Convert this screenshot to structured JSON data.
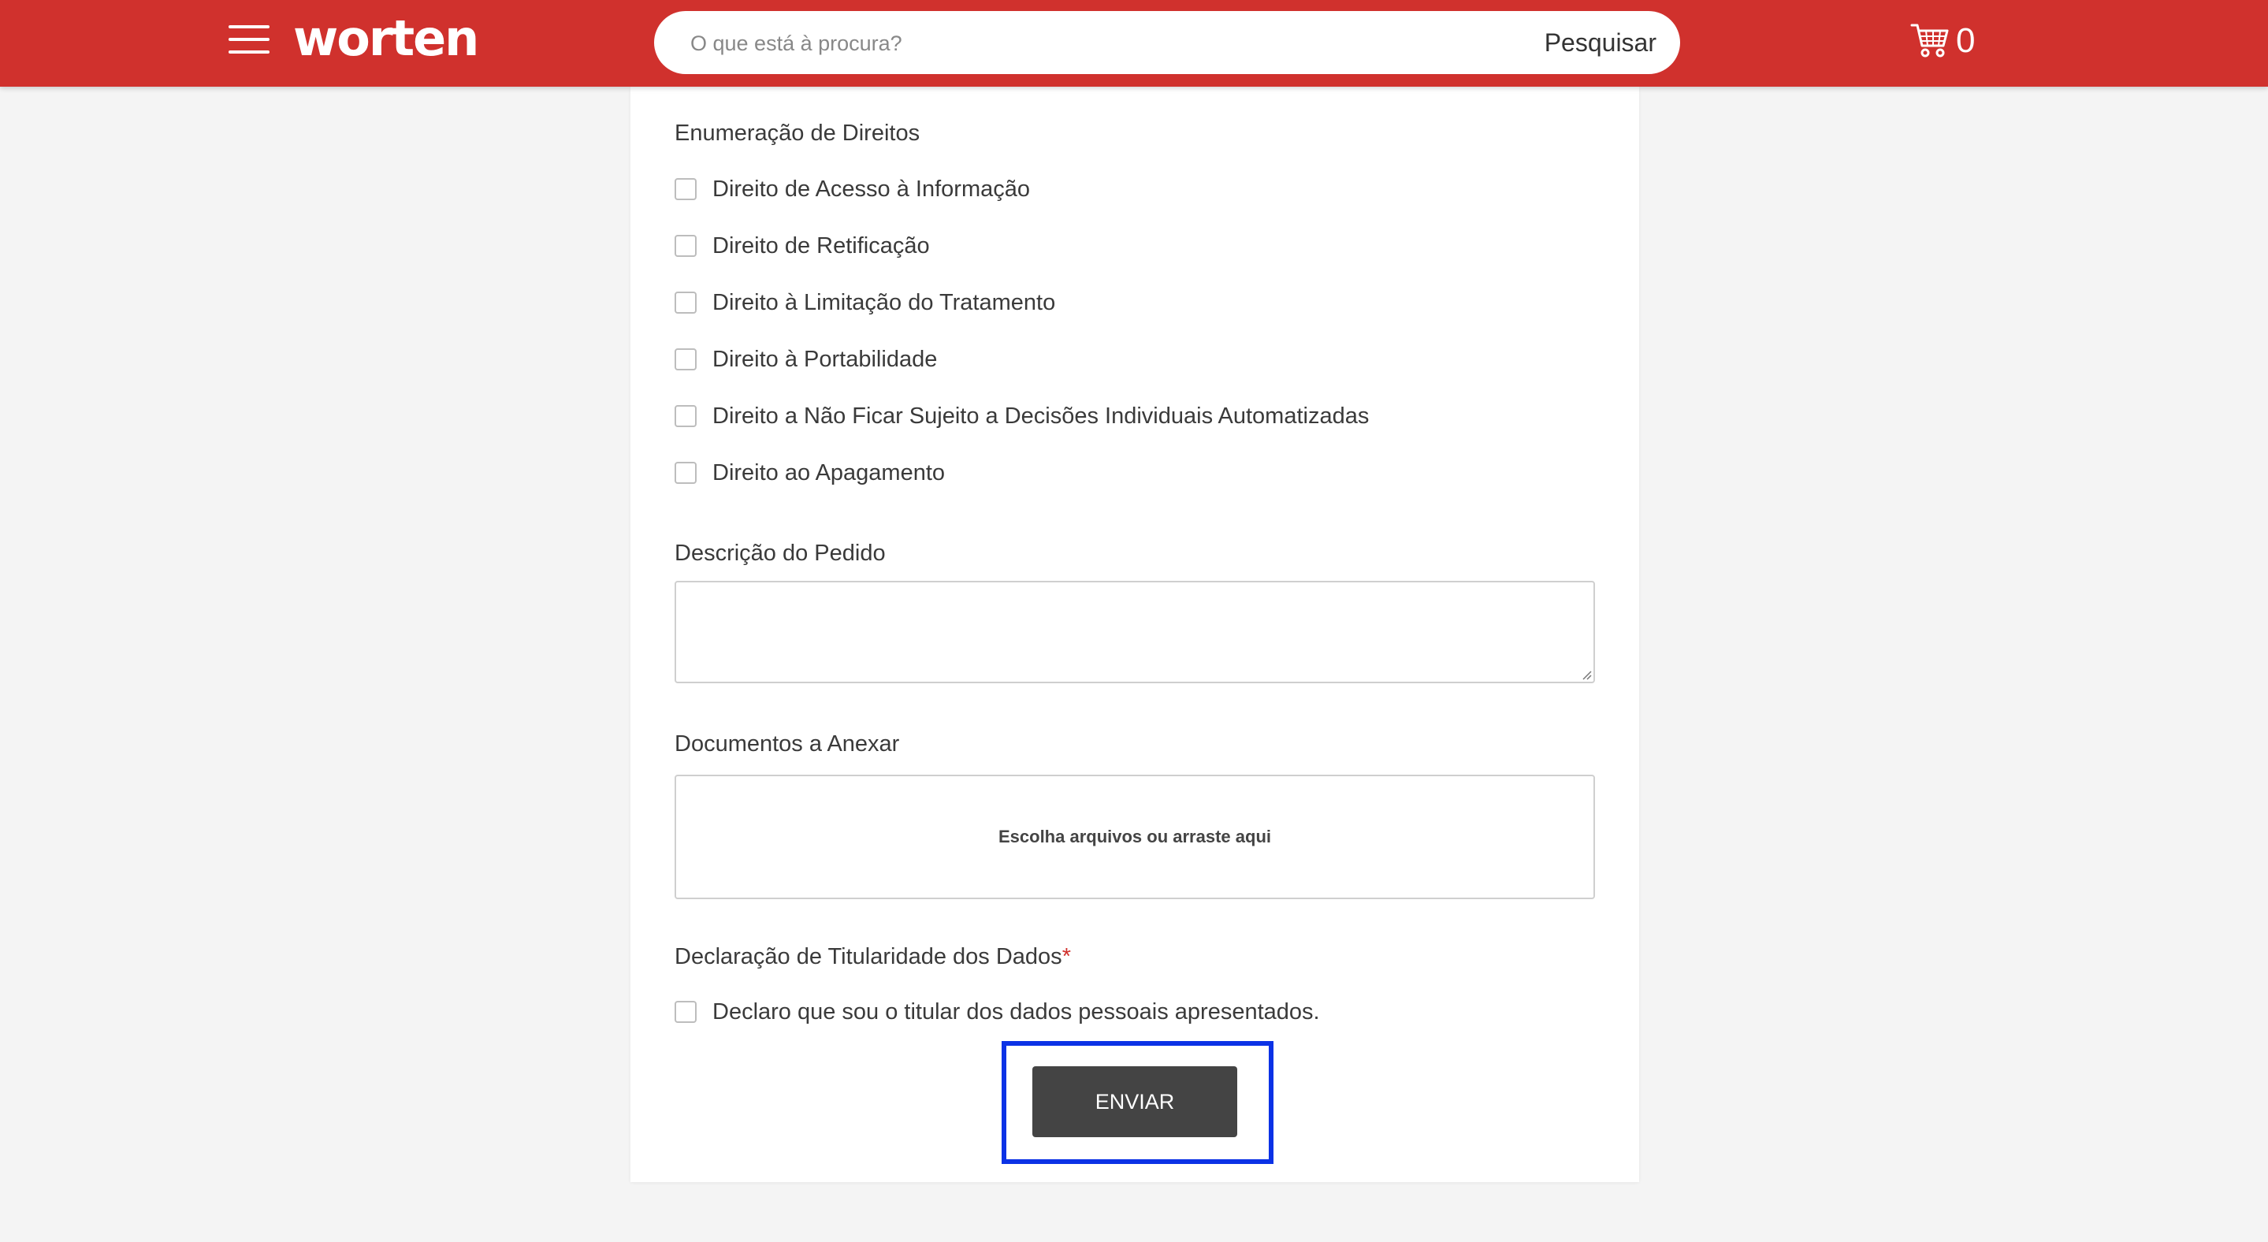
{
  "header": {
    "brand": "worten",
    "search_placeholder": "O que está à procura?",
    "search_button": "Pesquisar",
    "cart_count": "0",
    "brand_color": "#d0312d"
  },
  "form": {
    "rights_title": "Enumeração de Direitos",
    "rights": [
      "Direito de Acesso à Informação",
      "Direito de Retificação",
      "Direito à Limitação do Tratamento",
      "Direito à Portabilidade",
      "Direito a Não Ficar Sujeito a Decisões Individuais Automatizadas",
      "Direito ao Apagamento"
    ],
    "description_label": "Descrição do Pedido",
    "description_value": "",
    "attachments_label": "Documentos a Anexar",
    "dropzone_text": "Escolha arquivos ou arraste aqui",
    "declaration_label": "Declaração de Titularidade dos Dados",
    "required_mark": "*",
    "declaration_checkbox": "Declaro que sou o titular dos dados pessoais apresentados.",
    "submit_label": "ENVIAR"
  },
  "icons": {
    "menu": "hamburger-menu-icon",
    "cart": "shopping-cart-icon"
  }
}
